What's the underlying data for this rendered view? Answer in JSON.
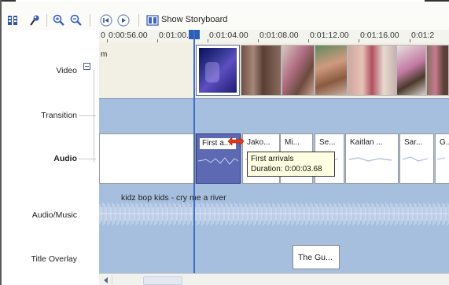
{
  "toolbar": {
    "show_storyboard_label": "Show Storyboard",
    "buttons": [
      {
        "icon": "storyboard-view-icon"
      },
      {
        "icon": "set-audio-levels-icon"
      },
      {
        "icon": "zoom-in-icon"
      },
      {
        "icon": "zoom-out-icon"
      },
      {
        "icon": "rewind-timeline-icon"
      },
      {
        "icon": "play-timeline-icon"
      },
      {
        "icon": "show-storyboard-icon"
      }
    ]
  },
  "ruler": {
    "ticks": [
      "0",
      "0:00:56.00",
      "0:01:00.00",
      "0:01:04.00",
      "0:01:08.00",
      "0:01:12.00",
      "0:01:16.00",
      "0:01:2"
    ]
  },
  "tracks": {
    "video": {
      "label": "Video",
      "partial_clip_text": "m"
    },
    "transition": {
      "label": "Transition"
    },
    "audio": {
      "label": "Audio",
      "clips": [
        "First a...",
        "Jako...",
        "Mi...",
        "Se...",
        "Kaitlan ...",
        "Sar...",
        "G..."
      ]
    },
    "music": {
      "label": "Audio/Music",
      "clip_name": "kidz bop kids - cry me a river"
    },
    "title_overlay": {
      "label": "Title Overlay",
      "clip_name": "The Gu..."
    }
  },
  "tooltip": {
    "line1": "First arrivals",
    "line2": "Duration:  0:00:03.68"
  },
  "colors": {
    "track_blue": "#a7bfdf",
    "selected_clip": "#5d69b2",
    "playhead": "#3c6ec6",
    "tooltip_bg": "#ffffe1",
    "resize_arrow": "#e8361a"
  }
}
